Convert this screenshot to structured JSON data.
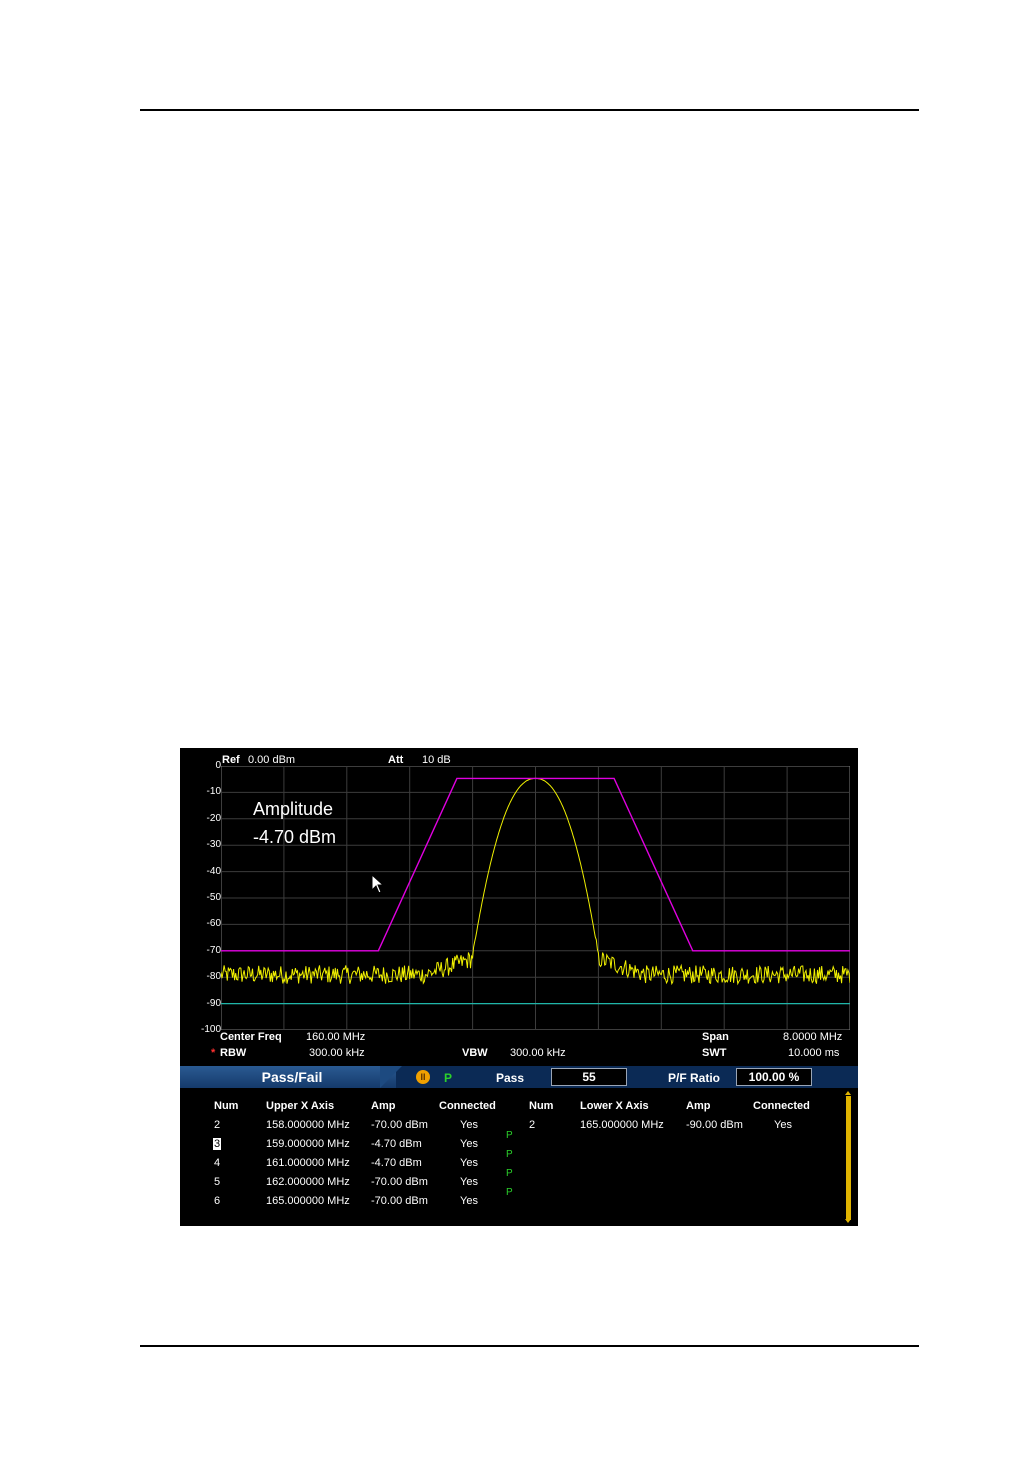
{
  "header": {
    "ref_label": "Ref",
    "ref_value": "0.00 dBm",
    "att_label": "Att",
    "att_value": "10 dB"
  },
  "y_axis": {
    "ticks": [
      "0",
      "-10",
      "-20",
      "-30",
      "-40",
      "-50",
      "-60",
      "-70",
      "-80",
      "-90",
      "-100"
    ]
  },
  "readout": {
    "title": "Amplitude",
    "value": "-4.70 dBm"
  },
  "footer": {
    "center_freq_label": "Center Freq",
    "center_freq_value": "160.00 MHz",
    "span_label": "Span",
    "span_value": "8.0000 MHz",
    "rbw_label": "RBW",
    "rbw_value": "300.00 kHz",
    "vbw_label": "VBW",
    "vbw_value": "300.00 kHz",
    "swt_label": "SWT",
    "swt_value": "10.000 ms",
    "rbw_marker": "*"
  },
  "pass_fail_bar": {
    "title": "Pass/Fail",
    "pause_glyph": "II",
    "state": "P",
    "pass_label": "Pass",
    "pass_count": "55",
    "ratio_label": "P/F Ratio",
    "ratio_value": "100.00 %"
  },
  "upper_table": {
    "headers": [
      "Num",
      "Upper X Axis",
      "Amp",
      "Connected"
    ],
    "rows": [
      {
        "num": "2",
        "x": "158.000000 MHz",
        "amp": "-70.00 dBm",
        "connected": "Yes"
      },
      {
        "num": "3",
        "x": "159.000000 MHz",
        "amp": "-4.70 dBm",
        "connected": "Yes"
      },
      {
        "num": "4",
        "x": "161.000000 MHz",
        "amp": "-4.70 dBm",
        "connected": "Yes"
      },
      {
        "num": "5",
        "x": "162.000000 MHz",
        "amp": "-70.00 dBm",
        "connected": "Yes"
      },
      {
        "num": "6",
        "x": "165.000000 MHz",
        "amp": "-70.00 dBm",
        "connected": "Yes"
      }
    ],
    "segment_results": [
      "P",
      "P",
      "P",
      "P"
    ]
  },
  "lower_table": {
    "headers": [
      "Num",
      "Lower X Axis",
      "Amp",
      "Connected"
    ],
    "rows": [
      {
        "num": "2",
        "x": "165.000000 MHz",
        "amp": "-90.00 dBm",
        "connected": "Yes"
      }
    ]
  },
  "chart_data": {
    "type": "line",
    "ylim": [
      -100,
      0
    ],
    "y_ticks": [
      0,
      -10,
      -20,
      -30,
      -40,
      -50,
      -60,
      -70,
      -80,
      -90,
      -100
    ],
    "xlim": [
      156,
      164
    ],
    "grid": true,
    "colors": {
      "upper_limit": "#e000e0",
      "trace": "#f0f000",
      "lower_limit": "#1fb5a8"
    },
    "series": [
      {
        "id": "upper_limit",
        "x": [
          156,
          158,
          159,
          161,
          162,
          164
        ],
        "y": [
          -70,
          -70,
          -4.7,
          -4.7,
          -70,
          -70
        ]
      },
      {
        "id": "lower_limit",
        "x": [
          156,
          164
        ],
        "y": [
          -90,
          -90
        ]
      },
      {
        "id": "trace",
        "noise_floor_dbm": -79,
        "peak_x": 160,
        "peak_dbm": -4.7,
        "edges_x": [
          159.2,
          160.8
        ],
        "edge_dbm": -72
      }
    ]
  }
}
